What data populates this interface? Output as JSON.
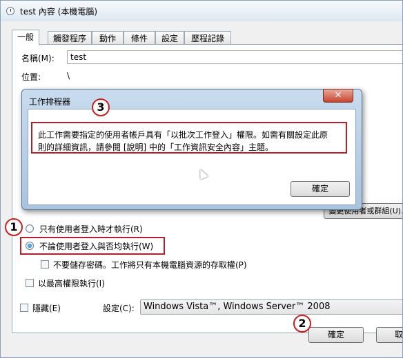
{
  "window": {
    "title": "test 內容 (本機電腦)"
  },
  "tabs": [
    {
      "label": "一般"
    },
    {
      "label": "觸發程序"
    },
    {
      "label": "動作"
    },
    {
      "label": "條件"
    },
    {
      "label": "設定"
    },
    {
      "label": "歷程記錄"
    }
  ],
  "general": {
    "name_label": "名稱(M):",
    "name_value": "test",
    "location_label": "位置:",
    "location_value": "\\",
    "change_user_button": "變更使用者或群組(U)...",
    "run_only_logged_on": "只有使用者登入時才執行(R)",
    "run_whether_logged_on": "不論使用者登入與否均執行(W)",
    "do_not_store_password": "不要儲存密碼。工作將只有本機電腦資源的存取權(P)",
    "run_highest_privileges": "以最高權限執行(I)",
    "hidden_label": "隱藏(E)",
    "configure_label": "設定(C):",
    "configure_value": "Windows Vista™, Windows Server™ 2008"
  },
  "footer": {
    "ok_label": "確定",
    "cancel_label": "取"
  },
  "dialog": {
    "title": "工作排程器",
    "close_glyph": "✕",
    "message_line1": "此工作需要指定的使用者帳戶具有「以批次工作登入」權限。如需有關設定此原",
    "message_line2": "則的詳細資訊，請參閱 [說明] 中的「工作資訊安全內容」主題。",
    "ok_label": "確定"
  },
  "annotations": {
    "badge1": "1",
    "badge2": "2",
    "badge3": "3"
  },
  "colors": {
    "callout_red": "#b51f2a",
    "dialog_frame": "#a9c3df",
    "selected_radio": "#1a67b8"
  }
}
